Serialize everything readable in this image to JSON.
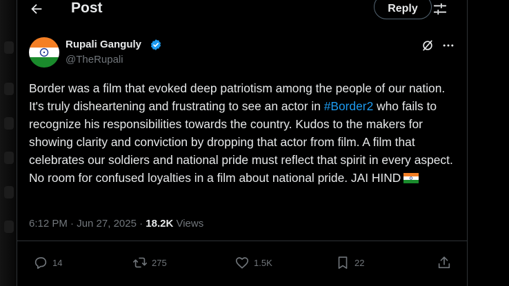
{
  "header": {
    "title": "Post",
    "reply_label": "Reply"
  },
  "post": {
    "author_name": "Rupali Ganguly",
    "author_handle": "@TheRupali",
    "text_before": "Border was a film that evoked deep patriotism among the people of our nation. It's truly disheartening and frustrating to see an actor in ",
    "hashtag": "#Border2",
    "text_after": " who fails to recognize his responsibilities towards the country. Kudos to the makers for showing clarity and conviction by dropping that actor from film. A film that celebrates our soldiers and national pride must reflect that spirit in every aspect. No room for confused loyalties in a film about national pride. JAI HIND",
    "timestamp": "6:12 PM · Jun 27, 2025 · ",
    "views_count": "18.2K",
    "views_label": " Views"
  },
  "actions": {
    "replies": "14",
    "reposts": "275",
    "likes": "1.5K",
    "bookmarks": "22"
  },
  "colors": {
    "accent": "#1d9bf0",
    "muted": "#71767b",
    "text": "#e7e9ea",
    "background": "#000000"
  },
  "icons": [
    "back-arrow-icon",
    "filter-icon",
    "verified-badge-icon",
    "grok-icon",
    "more-icon",
    "reply-icon",
    "repost-icon",
    "like-icon",
    "bookmark-icon",
    "share-icon",
    "india-flag-icon"
  ]
}
